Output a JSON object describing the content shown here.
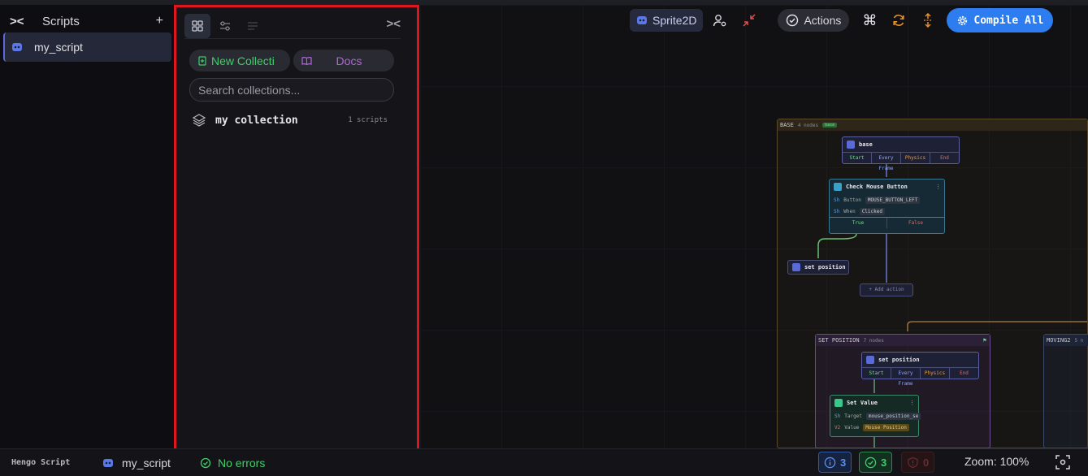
{
  "scripts_panel": {
    "title": "Scripts",
    "add_label": "+",
    "items": [
      {
        "label": "my_script"
      }
    ]
  },
  "collections_panel": {
    "new_collection_label": "New Collecti",
    "docs_label": "Docs",
    "search_placeholder": "Search collections...",
    "items": [
      {
        "name": "my collection",
        "count": "1 scripts"
      }
    ]
  },
  "toolbar": {
    "object_type": "Sprite2D",
    "actions_label": "Actions",
    "compile_label": "Compile All"
  },
  "canvas": {
    "groups": [
      {
        "title": "BASE",
        "sub": "4 nodes",
        "tag": "base"
      },
      {
        "title": "SET POSITION",
        "sub": "7 nodes"
      },
      {
        "title": "MOVING2",
        "sub": "5 n"
      }
    ],
    "nodes": {
      "base": {
        "title": "base",
        "events": [
          "Start",
          "Every Frame",
          "Physics",
          "End"
        ]
      },
      "check": {
        "title": "Check Mouse Button",
        "rows": [
          {
            "label": "Button",
            "value": "MOUSE_BUTTON_LEFT"
          },
          {
            "label": "When",
            "value": "Clicked"
          }
        ],
        "branches": [
          "True",
          "False"
        ]
      },
      "setpos_action": {
        "title": "set position"
      },
      "add_action": {
        "title": "+ Add action"
      },
      "setpos": {
        "title": "set position",
        "events": [
          "Start",
          "Every Frame",
          "Physics",
          "End"
        ]
      },
      "setvalue": {
        "title": "Set Value",
        "rows": [
          {
            "label": "Target",
            "value": "mouse_position_se"
          },
          {
            "label": "Value",
            "value": "Mouse Position"
          }
        ]
      }
    }
  },
  "status_bar": {
    "brand": "Hengo Script",
    "script": "my_script",
    "errors": "No errors",
    "info_count": "3",
    "ok_count": "3",
    "error_count": "0",
    "zoom": "Zoom: 100%"
  },
  "colors": {
    "accent_blue": "#2e7df0",
    "success_green": "#3fcf6a",
    "docs_purple": "#b065d8",
    "highlight_red": "#e0151f"
  }
}
